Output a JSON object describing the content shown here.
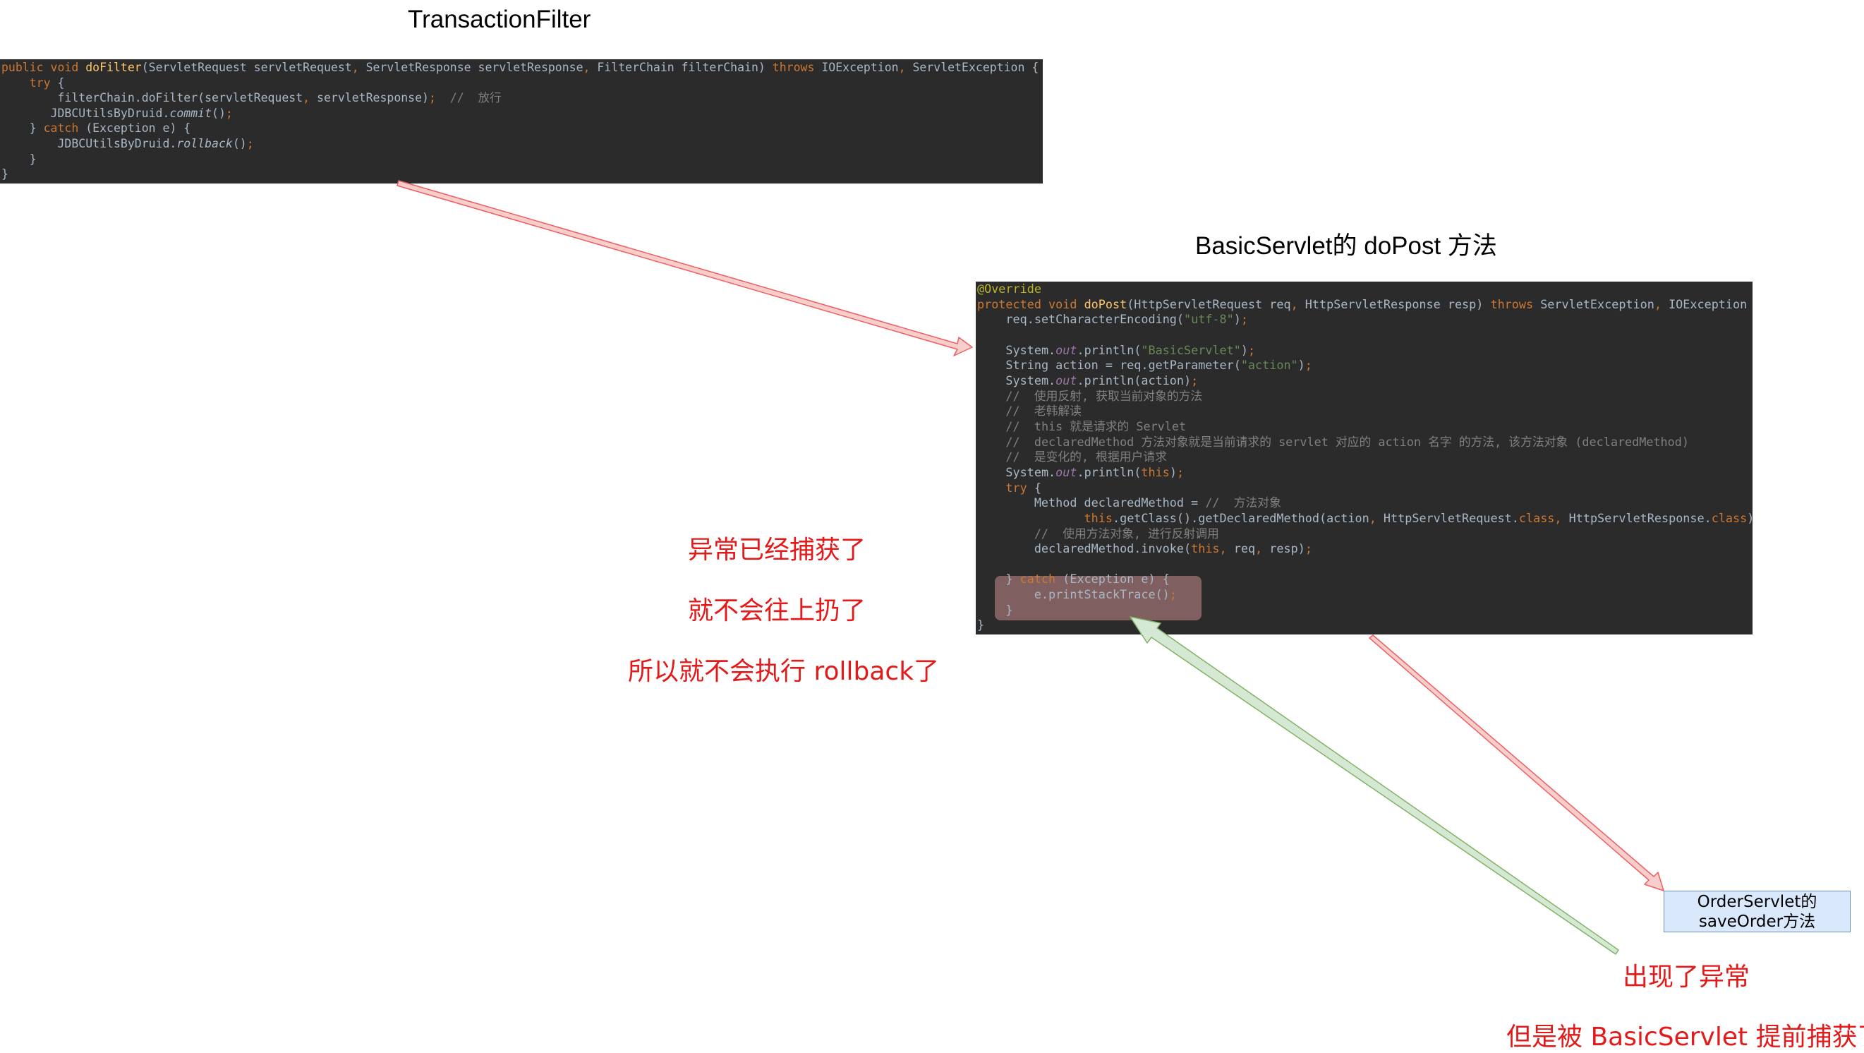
{
  "titles": {
    "filter": "TransactionFilter",
    "servlet": "BasicServlet的 doPost 方法"
  },
  "filter_code": {
    "line1_kw": "public void ",
    "line1_fn": "doFilter",
    "line1_a": "(ServletRequest servletRequest",
    "line1_b": "ServletResponse servletResponse",
    "line1_c": "FilterChain filterChain) ",
    "line1_throws": "throws ",
    "line1_d": "IOException",
    "line1_e": "ServletException {",
    "line2_kw": "try ",
    "line2_b": "{",
    "line3_a": "filterChain.doFilter(servletRequest",
    "line3_b": "servletResponse)",
    "line3_cm": "//  放行",
    "line4_a": "JDBCUtilsByDruid.",
    "line4_it": "commit",
    "line4_b": "()",
    "line5_a": "} ",
    "line5_kw": "catch ",
    "line5_b": "(Exception e) {",
    "line6_a": "JDBCUtilsByDruid.",
    "line6_it": "rollback",
    "line6_b": "()",
    "line7": "}",
    "line8": "}"
  },
  "servlet_code": {
    "l1": "@Override",
    "l2_kw": "protected void ",
    "l2_fn": "doPost",
    "l2_a": "(HttpServletRequest req",
    "l2_b": "HttpServletResponse resp) ",
    "l2_throws": "throws ",
    "l2_c": "ServletException",
    "l2_d": "IOException {",
    "l3_a": "req.setCharacterEncoding(",
    "l3_st": "\"utf-8\"",
    "l3_b": ")",
    "l5_a": "System.",
    "l5_out": "out",
    "l5_b": ".println(",
    "l5_st": "\"BasicServlet\"",
    "l5_c": ")",
    "l6_a": "String action = req.getParameter(",
    "l6_st": "\"action\"",
    "l6_b": ")",
    "l7_a": "System.",
    "l7_out": "out",
    "l7_b": ".println(action)",
    "c1": "//  使用反射, 获取当前对象的方法",
    "c2": "//  老韩解读",
    "c3": "//  this 就是请求的 Servlet",
    "c4": "//  declaredMethod 方法对象就是当前请求的 servlet 对应的 action 名字 的方法, 该方法对象 (declaredMethod)",
    "c5": "//  是变化的, 根据用户请求",
    "l13_a": "System.",
    "l13_out": "out",
    "l13_b": ".println(",
    "l13_this": "this",
    "l13_c": ")",
    "l14_kw": "try ",
    "l14_b": "{",
    "l15_a": "Method declaredMethod = ",
    "l15_cm": "//  方法对象",
    "l16_this": "this",
    "l16_a": ".getClass().getDeclaredMethod(action",
    "l16_b": "HttpServletRequest.",
    "l16_class1": "class",
    "l16_c": "HttpServletResponse.",
    "l16_class2": "class",
    "l16_d": ")",
    "l17_cm": "//  使用方法对象, 进行反射调用",
    "l18_a": "declaredMethod.invoke(",
    "l18_this": "this",
    "l18_b": "req",
    "l18_c": "resp)",
    "l20_a": "} ",
    "l20_kw": "catch ",
    "l20_b": "(Exception e) {",
    "l21_a": "e.printStackTrace()",
    "l22": "}",
    "l23": "}"
  },
  "notes": {
    "caught": "异常已经捕获了",
    "no_throw": "就不会往上扔了",
    "no_rollback": "所以就不会执行 rollback了",
    "exception_occurred": "出现了异常",
    "caught_early": "但是被 BasicServlet 提前捕获了"
  },
  "order_box": {
    "line1": "OrderServlet的",
    "line2": "saveOrder方法"
  },
  "colors": {
    "note_red": "#e31a1a",
    "code_bg": "#2b2b2b",
    "arrow_red_fill": "#f8cecc",
    "arrow_red_stroke": "#ee5f5f",
    "arrow_green_fill": "#d5e8d4",
    "arrow_green_stroke": "#82b366",
    "box_fill": "#dae8fc",
    "box_stroke": "#6c8ebf"
  }
}
